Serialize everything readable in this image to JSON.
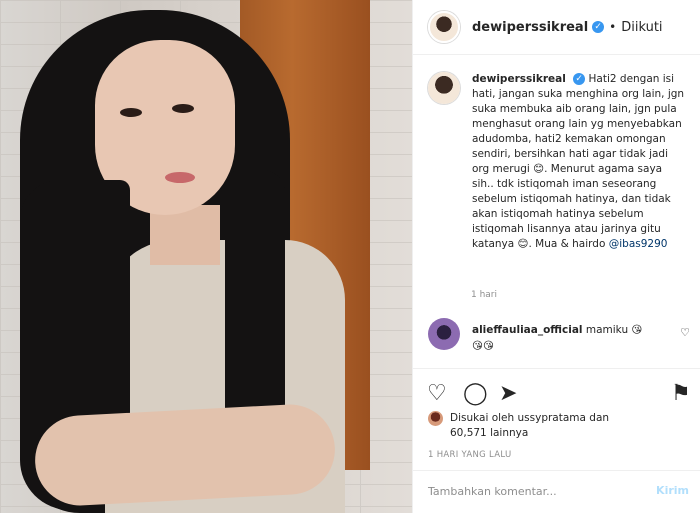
{
  "post": {
    "username": "dewiperssikreal",
    "verified_mark": "✓",
    "dot": "•",
    "follow_status": "Diikuti",
    "caption_username": "dewiperssikreal",
    "caption_body": "Hati2 dengan isi hati, jangan suka menghina org lain, jgn suka membuka aib orang lain, jgn pula menghasut orang lain yg menyebabkan adudomba, hati2 kemakan omongan sendiri, bersihkan hati agar tidak jadi org merugi 😊. Menurut agama saya sih.. tdk istiqomah iman seseorang sebelum istiqomah hatinya, dan tidak akan istiqomah hatinya sebelum istiqomah lisannya atau jarinya gitu katanya 😊. Mua & hairdo ",
    "caption_mention": "@ibas9290",
    "caption_time": "1 hari"
  },
  "comment": {
    "username": "alieffauliaa_official",
    "text": "mamiku 😘",
    "text2": "😘😘",
    "heart": "♡"
  },
  "actions": {
    "like_icon": "♡",
    "comment_icon": "◯",
    "share_icon": "➤",
    "save_icon": "⚑"
  },
  "likes": {
    "line1": "Disukai oleh ussypratama dan",
    "line2": "60,571 lainnya"
  },
  "posted": "1 HARI YANG LALU",
  "add_comment": {
    "placeholder": "Tambahkan komentar...",
    "post_label": "Kirim"
  }
}
